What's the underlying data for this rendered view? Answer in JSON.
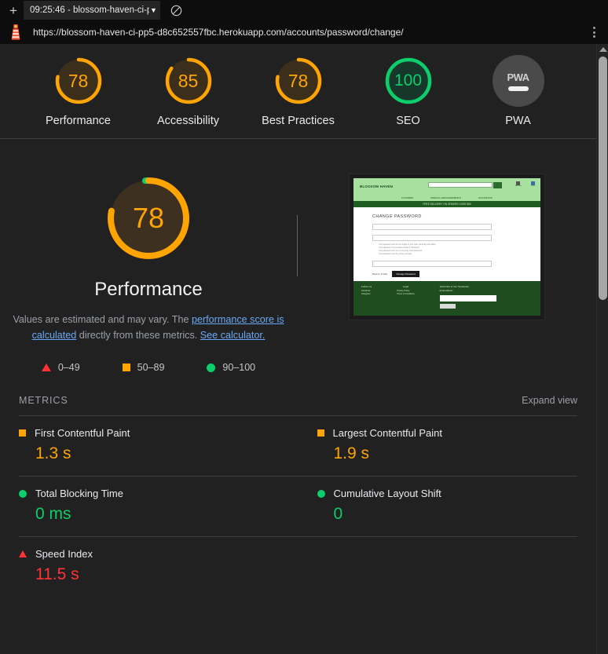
{
  "browser": {
    "new_tab_label": "+",
    "tab_title": "09:25:46 - blossom-haven-ci-p",
    "tab_caret": "▼",
    "block_icon": "no-entry",
    "url": "https://blossom-haven-ci-pp5-d8c652557fbc.herokuapp.com/accounts/password/change/",
    "menu_icon": "kebab-menu"
  },
  "colors": {
    "orange": "#ffa400",
    "green": "#0cce6b",
    "red": "#ff3333",
    "gray": "#757575",
    "link": "#6aa9f4",
    "text": "#e8eaed",
    "muted": "#9aa0a6"
  },
  "gauges": [
    {
      "label": "Performance",
      "score": "78",
      "value": 78,
      "state": "average"
    },
    {
      "label": "Accessibility",
      "score": "85",
      "value": 85,
      "state": "average"
    },
    {
      "label": "Best Practices",
      "score": "78",
      "value": 78,
      "state": "average"
    },
    {
      "label": "SEO",
      "score": "100",
      "value": 100,
      "state": "pass"
    },
    {
      "label": "PWA",
      "score": "PWA",
      "value": 0,
      "state": "none"
    }
  ],
  "category": {
    "score": "78",
    "value": 78,
    "title": "Performance",
    "desc_part1": "Values are estimated and may vary. The ",
    "desc_link1": "performance score is calculated",
    "desc_part2": " directly from these metrics. ",
    "desc_link2": "See calculator.",
    "legend": [
      {
        "shape": "triangle",
        "range": "0–49"
      },
      {
        "shape": "square",
        "range": "50–89"
      },
      {
        "shape": "circle",
        "range": "90–100"
      }
    ]
  },
  "thumbnail": {
    "alt": "page-screenshot-thumbnail",
    "site_logo": "BLOSSOM HAVEN",
    "search_placeholder": "Search...",
    "nav": [
      "FLOWERS",
      "SPECIAL ARRANGEMENTS",
      "OCCASIONS"
    ],
    "banner": "FREE DELIVERY ON ORDERS OVER $50",
    "heading": "CHANGE PASSWORD",
    "bullets": [
      "Your password can't be too similar to your other personal information.",
      "Your password must contain at least 8 characters.",
      "Your password can't be a commonly used password.",
      "Your password can't be entirely numeric."
    ],
    "btn_secondary": "Back to Profile",
    "btn_primary": "Change Password",
    "footer_cols": [
      {
        "head": "Follow Us",
        "lines": [
          "Facebook",
          "Instagram"
        ]
      },
      {
        "head": "Legal",
        "lines": [
          "Privacy Policy",
          "Terms & Conditions"
        ]
      },
      {
        "head": "Subscribe to Our Newsletter",
        "lines": [
          "Email address:"
        ]
      }
    ],
    "subscribe_btn": "Subscribe"
  },
  "metrics_section": {
    "title": "METRICS",
    "expand_label": "Expand view"
  },
  "metrics": [
    {
      "name": "First Contentful Paint",
      "value": "1.3 s",
      "state": "average",
      "shape": "square"
    },
    {
      "name": "Largest Contentful Paint",
      "value": "1.9 s",
      "state": "average",
      "shape": "square"
    },
    {
      "name": "Total Blocking Time",
      "value": "0 ms",
      "state": "pass",
      "shape": "circle"
    },
    {
      "name": "Cumulative Layout Shift",
      "value": "0",
      "state": "pass",
      "shape": "circle"
    },
    {
      "name": "Speed Index",
      "value": "11.5 s",
      "state": "fail",
      "shape": "triangle"
    }
  ]
}
